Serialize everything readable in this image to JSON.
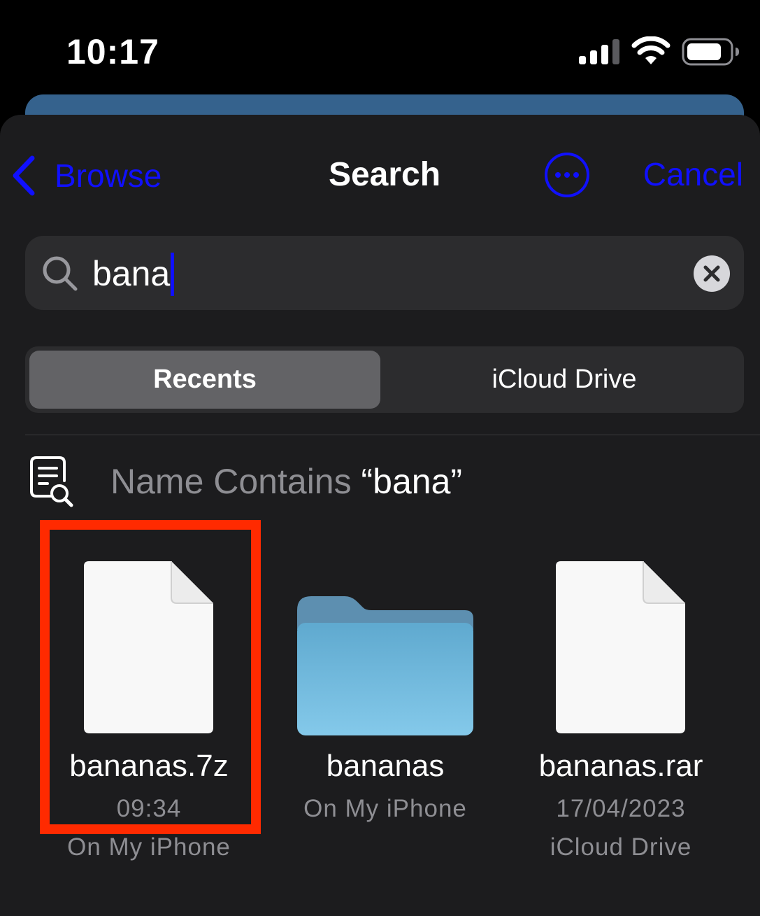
{
  "status_bar": {
    "time": "10:17",
    "signal_icon": "cellular-signal-icon",
    "wifi_icon": "wifi-icon",
    "battery_icon": "battery-icon"
  },
  "nav": {
    "back_label": "Browse",
    "title": "Search",
    "more_icon": "ellipsis-circle-icon",
    "cancel_label": "Cancel"
  },
  "search": {
    "value": "bana",
    "clear_icon": "clear-icon"
  },
  "segments": [
    {
      "label": "Recents",
      "selected": true
    },
    {
      "label": "iCloud Drive",
      "selected": false
    }
  ],
  "filter": {
    "prefix": "Name Contains ",
    "term": "“bana”",
    "icon": "doc-search-icon"
  },
  "files": [
    {
      "name": "bananas.7z",
      "meta1": "09:34",
      "meta2": "On My iPhone",
      "kind": "document",
      "highlighted": true
    },
    {
      "name": "bananas",
      "meta1": "On My iPhone",
      "meta2": "",
      "kind": "folder",
      "highlighted": false
    },
    {
      "name": "bananas.rar",
      "meta1": "17/04/2023",
      "meta2": "iCloud Drive",
      "kind": "document",
      "highlighted": false
    }
  ],
  "colors": {
    "accent": "#1010ff",
    "sheet_background": "#1c1c1e",
    "highlight": "#ff2a00",
    "folder": "#6fb8df"
  }
}
